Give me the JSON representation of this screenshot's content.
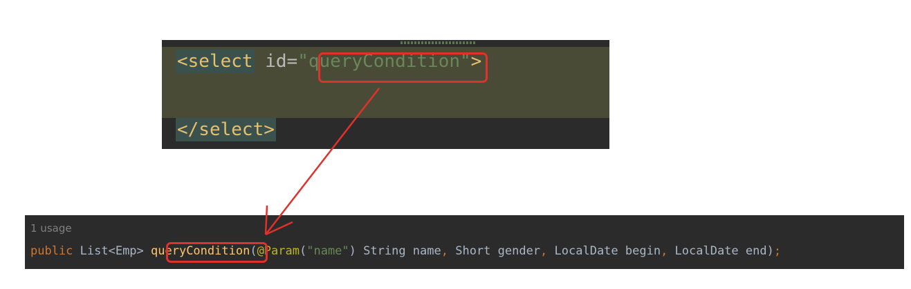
{
  "xml": {
    "open_tag": "<select",
    "attr_name": " id=",
    "attr_quote_open": "\"",
    "attr_value": "queryCondition",
    "attr_quote_close": "\"",
    "open_tag_end": ">",
    "close_tag": "</select>"
  },
  "java": {
    "usage": "1 usage",
    "kw_public": "public",
    "ret_type": " List<Emp> ",
    "method": "queryCondition",
    "paren_open": "(",
    "annotation": "@Param",
    "ann_paren_open": "(",
    "ann_string": "\"name\"",
    "ann_paren_close": ")",
    "param1": " String name",
    "comma1": ",",
    "param2": " Short gender",
    "comma2": ",",
    "param3": " LocalDate begin",
    "comma3": ",",
    "param4": " LocalDate end",
    "paren_close": ")",
    "semicolon": ";"
  },
  "colors": {
    "highlight_box": "#e0312b",
    "arrow": "#e0312b",
    "editor_bg": "#2b2b2b",
    "line_highlight": "#4a4b37"
  }
}
